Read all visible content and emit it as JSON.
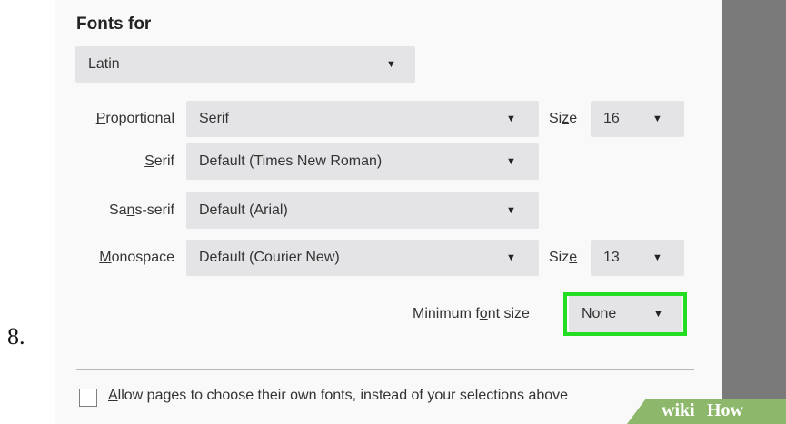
{
  "step_number": "8.",
  "fonts_for": {
    "heading": "Fonts for",
    "selected": "Latin"
  },
  "proportional": {
    "label_u": "P",
    "label_rest": "roportional",
    "value": "Serif",
    "size_label_pre": "Si",
    "size_label_u": "z",
    "size_label_post": "e",
    "size_value": "16"
  },
  "serif": {
    "label_u": "S",
    "label_rest": "erif",
    "value": "Default (Times New Roman)"
  },
  "sans_serif": {
    "label_pre": "Sa",
    "label_u": "n",
    "label_post": "s-serif",
    "value": "Default (Arial)"
  },
  "monospace": {
    "label_u": "M",
    "label_rest": "onospace",
    "value": "Default (Courier New)",
    "size_label_pre": "Siz",
    "size_label_u": "e",
    "size_label_post": "",
    "size_value": "13"
  },
  "minimum_font_size": {
    "label_pre": "Minimum f",
    "label_u": "o",
    "label_post": "nt size",
    "value": "None"
  },
  "allow_pages": {
    "label_u": "A",
    "label_rest": "llow pages to choose their own fonts, instead of your selections above",
    "checked": false
  },
  "watermark": {
    "wiki": "wiki",
    "how": "How"
  },
  "colors": {
    "highlight": "#22dd22",
    "dropdown_bg": "#e4e4e6",
    "side_panel": "#7a7a7a",
    "watermark": "#8db86b"
  },
  "icons": {
    "dropdown": "caret-down-icon"
  }
}
